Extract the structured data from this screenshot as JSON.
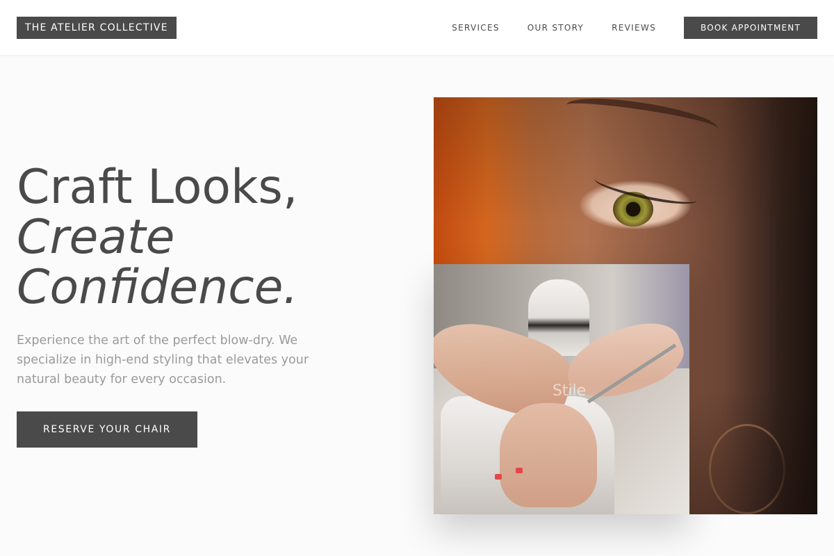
{
  "header": {
    "logo": "THE ATELIER COLLECTIVE",
    "nav": [
      {
        "label": "SERVICES"
      },
      {
        "label": "OUR STORY"
      },
      {
        "label": "REVIEWS"
      }
    ],
    "cta": "BOOK APPOINTMENT"
  },
  "hero": {
    "title_line1": "Craft Looks,",
    "title_line2": "Create",
    "title_line3": "Confidence.",
    "description": "Experience the art of the perfect blow-dry. We specialize in high-end styling that elevates your natural beauty for every occasion.",
    "button": "RESERVE YOUR CHAIR"
  },
  "images": {
    "main": "eye-closeup-photo",
    "overlay": "manicure-photo",
    "overlay_watermark": "Stile"
  },
  "colors": {
    "primary": "#4a4a4a",
    "background": "#fbfbfb",
    "muted_text": "#9a9a9a",
    "white": "#ffffff"
  }
}
